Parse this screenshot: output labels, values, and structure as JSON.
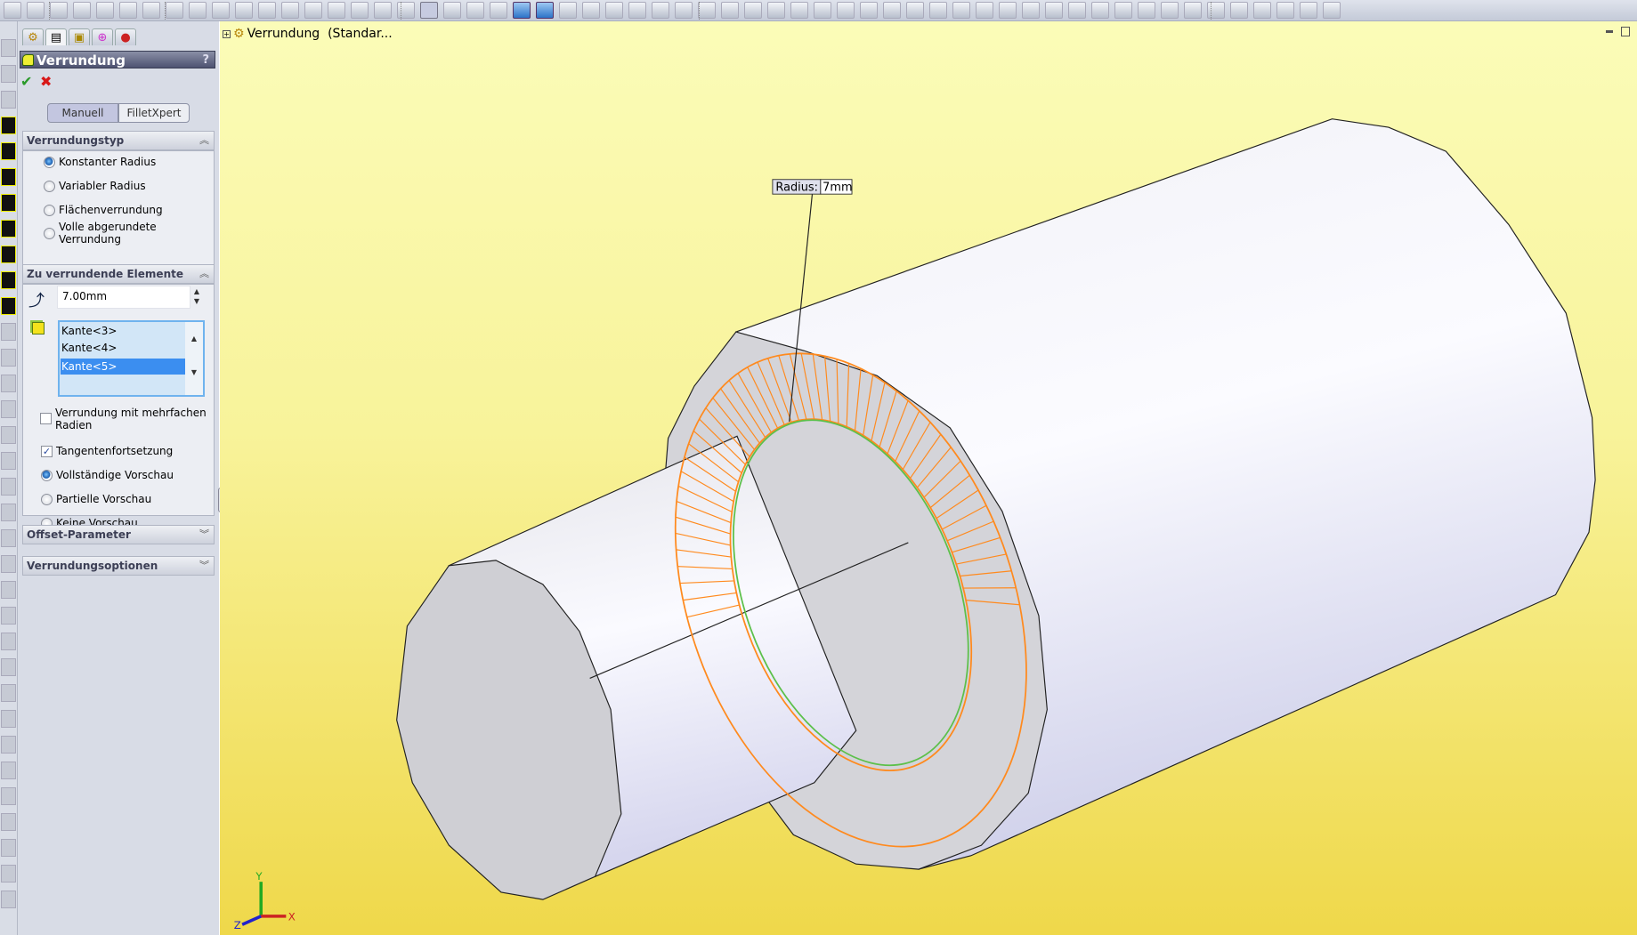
{
  "window": {
    "feature_tree_label": "Verrundung  (Standar...",
    "minimize_icon": "minimize-icon",
    "restore_icon": "restore-icon"
  },
  "property_manager": {
    "title": "Verrundung",
    "help": "?",
    "ok_icon": "check-icon",
    "cancel_icon": "close-icon",
    "tabs": [
      "feature-manager-icon",
      "property-manager-icon",
      "configuration-manager-icon",
      "dimxpert-icon",
      "display-manager-icon"
    ],
    "mode_buttons": [
      {
        "label": "Manuell",
        "selected": true
      },
      {
        "label": "FilletXpert",
        "selected": false
      }
    ],
    "fillet_type": {
      "header": "Verrundungstyp",
      "options": [
        {
          "label": "Konstanter Radius",
          "selected": true
        },
        {
          "label": "Variabler Radius",
          "selected": false
        },
        {
          "label": "Flächenverrundung",
          "selected": false
        },
        {
          "label": "Volle abgerundete Verrundung",
          "selected": false
        }
      ]
    },
    "items": {
      "header": "Zu verrundende Elemente",
      "radius_value": "7.00mm",
      "edges": [
        {
          "label": "Kante<3>",
          "selected": false
        },
        {
          "label": "Kante<4>",
          "selected": false
        },
        {
          "label": "Kante<5>",
          "selected": true
        }
      ],
      "multi_radius": {
        "label": "Verrundung mit mehrfachen Radien",
        "checked": false
      },
      "tangent": {
        "label": "Tangentenfortsetzung",
        "checked": true
      },
      "preview": [
        {
          "label": "Vollständige Vorschau",
          "selected": true
        },
        {
          "label": "Partielle Vorschau",
          "selected": false
        },
        {
          "label": "Keine Vorschau",
          "selected": false
        }
      ]
    },
    "offset": {
      "header": "Offset-Parameter"
    },
    "options": {
      "header": "Verrundungsoptionen"
    }
  },
  "callout": {
    "label": "Radius:",
    "value": "7mm"
  },
  "triad": {
    "x": "X",
    "y": "Y",
    "z": "Z"
  },
  "colors": {
    "preview": "#ff8a1e",
    "edge": "#5cc04a",
    "background_top": "#fbfcb8",
    "background_bottom": "#efd84a",
    "selected": "#3b8ef0"
  }
}
